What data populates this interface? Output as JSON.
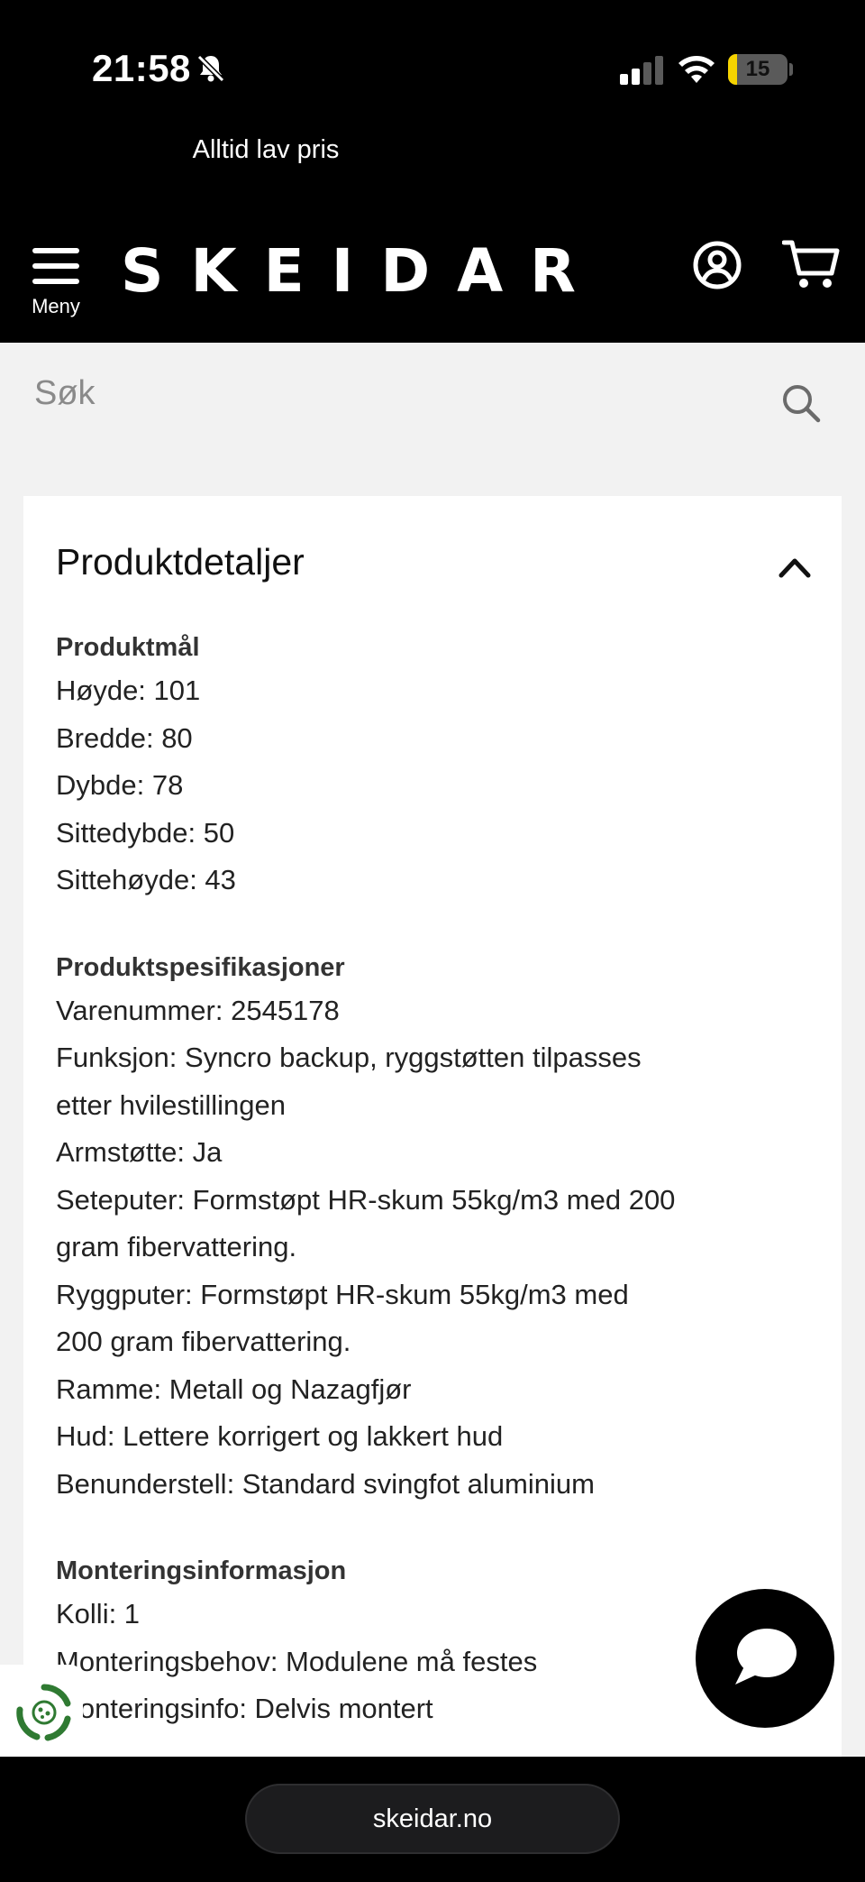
{
  "status_bar": {
    "time": "21:58",
    "battery_level": "15",
    "battery_color": "#f5d300"
  },
  "promo_text": "Alltid lav pris",
  "header": {
    "menu_label": "Meny",
    "logo_text": "SKEIDAR",
    "icons": [
      "menu-icon",
      "account-icon",
      "cart-icon"
    ]
  },
  "search": {
    "placeholder": "Søk",
    "icon": "search-icon"
  },
  "product_details": {
    "title": "Produktdetaljer",
    "expanded": true,
    "sections": [
      {
        "title": "Produktmål",
        "lines": [
          "Høyde: 101",
          "Bredde: 80",
          "Dybde: 78",
          "Sittedybde: 50",
          "Sittehøyde: 43"
        ]
      },
      {
        "title": "Produktspesifikasjoner",
        "lines": [
          "Varenummer: 2545178",
          "Funksjon: Syncro backup, ryggstøtten tilpasses",
          "etter hvilestillingen",
          "Armstøtte: Ja",
          "Seteputer: Formstøpt HR-skum 55kg/m3 med 200",
          "gram fibervattering.",
          "Ryggputer: Formstøpt HR-skum 55kg/m3 med",
          "200 gram fibervattering.",
          "Ramme: Metall og Nazagfjør",
          "Hud: Lettere korrigert og lakkert hud",
          "Benunderstell: Standard svingfot aluminium"
        ]
      },
      {
        "title": "Monteringsinformasjon",
        "lines": [
          "Kolli: 1",
          "Monteringsbehov: Modulene må festes",
          "Monteringsinfo: Delvis montert"
        ]
      }
    ]
  },
  "browser": {
    "url": "skeidar.no"
  }
}
